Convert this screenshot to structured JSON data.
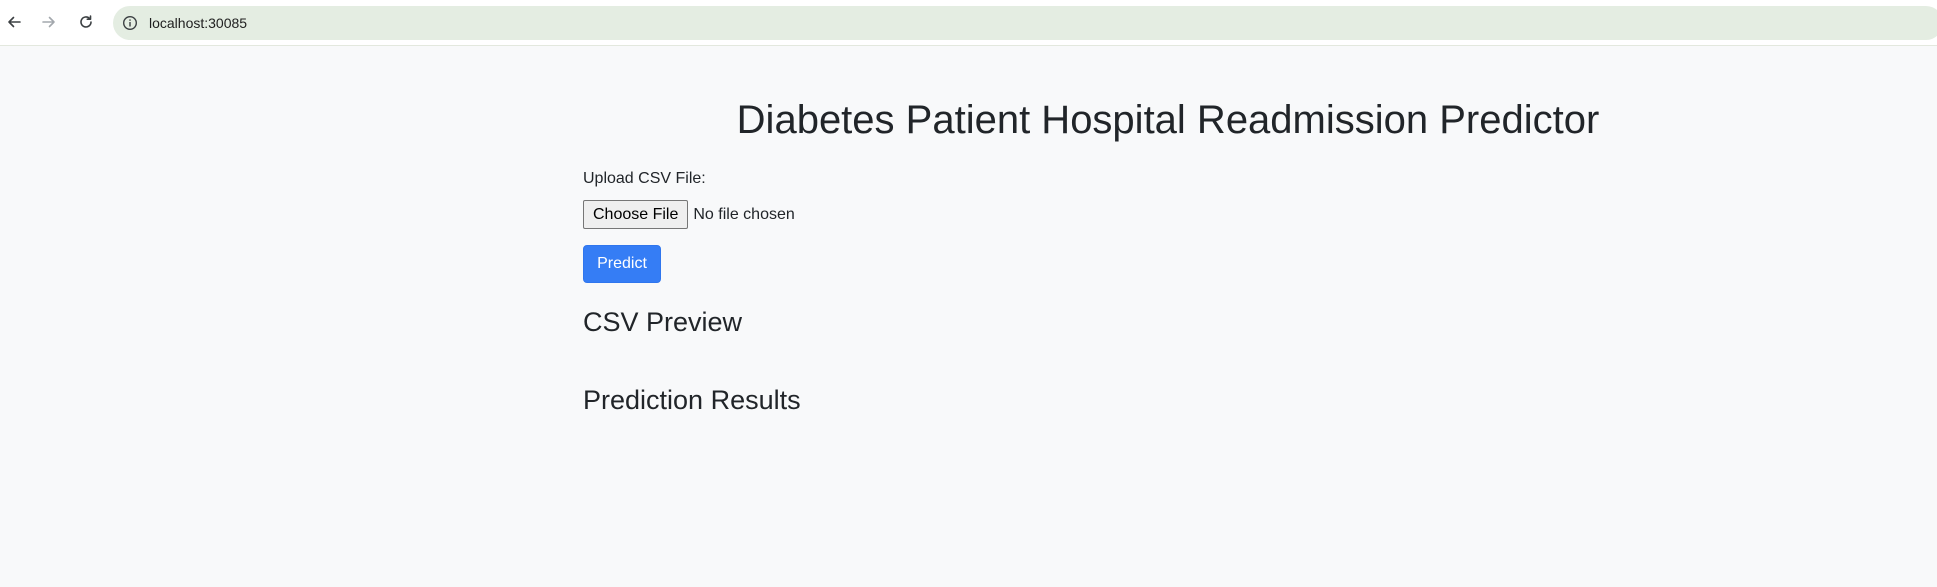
{
  "browser": {
    "url": "localhost:30085",
    "icons": {
      "back": "arrow-left-icon",
      "forward": "arrow-right-icon",
      "reload": "reload-icon",
      "site_info": "info-icon"
    }
  },
  "page": {
    "title": "Diabetes Patient Hospital Readmission Predictor",
    "upload_label": "Upload CSV File:",
    "file_input": {
      "button_label": "Choose File",
      "status": "No file chosen"
    },
    "predict_label": "Predict",
    "csv_preview_heading": "CSV Preview",
    "results_heading": "Prediction Results"
  },
  "colors": {
    "primary_button": "#357df5",
    "omnibox": "#e4ede2",
    "page_background": "#f8f9fa"
  }
}
